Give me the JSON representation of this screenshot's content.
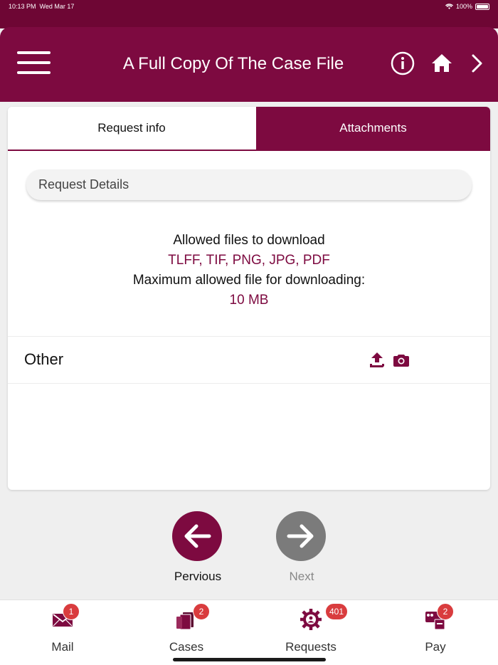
{
  "status_bar": {
    "time": "10:13 PM",
    "date": "Wed Mar 17",
    "battery": "100%"
  },
  "header": {
    "title": "A Full Copy Of The Case File"
  },
  "tabs": [
    {
      "label": "Request info",
      "active": false
    },
    {
      "label": "Attachments",
      "active": true
    }
  ],
  "request_details": {
    "label": "Request Details"
  },
  "info": {
    "allowed_label": "Allowed files to download",
    "allowed_types": "TLFF, TIF, PNG, JPG, PDF",
    "max_label": "Maximum allowed file for downloading:",
    "max_value": "10 MB"
  },
  "attachments": [
    {
      "label": "Other"
    }
  ],
  "navigation": {
    "previous_label": "Pervious",
    "next_label": "Next"
  },
  "tabbar": [
    {
      "label": "Mail",
      "badge": "1",
      "icon": "mail-icon"
    },
    {
      "label": "Cases",
      "badge": "2",
      "icon": "cases-icon"
    },
    {
      "label": "Requests",
      "badge": "401",
      "icon": "requests-icon"
    },
    {
      "label": "Pay",
      "badge": "2",
      "icon": "pay-icon"
    }
  ],
  "colors": {
    "brand": "#7d0a40",
    "brand_dark": "#6e0634",
    "badge": "#d93c3e",
    "disabled": "#7b7b7b"
  }
}
